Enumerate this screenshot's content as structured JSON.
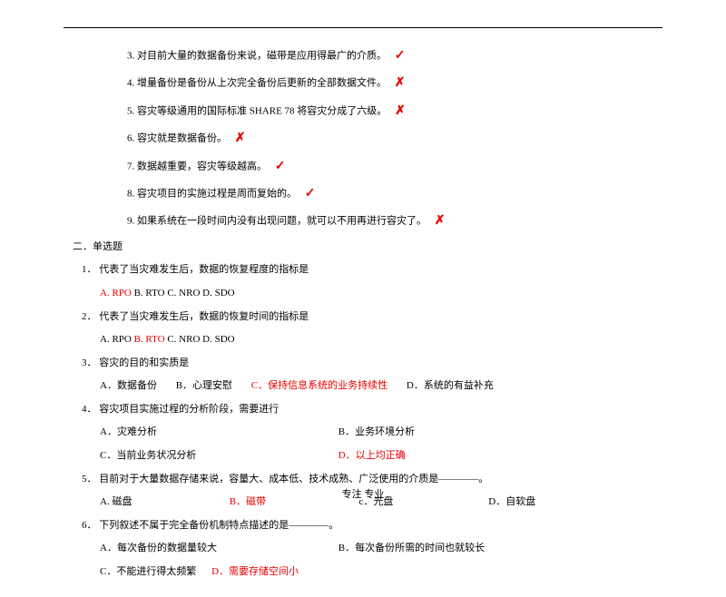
{
  "tf": {
    "items": [
      {
        "num": "3.",
        "text": "对目前大量的数据备份来说，磁带是应用得最广的介质。",
        "mark": "check"
      },
      {
        "num": "4.",
        "text": "增量备份是备份从上次完全备份后更新的全部数据文件。",
        "mark": "cross"
      },
      {
        "num": "5.",
        "text": "容灾等级通用的国际标准 SHARE 78 将容灾分成了六级。",
        "mark": "cross"
      },
      {
        "num": "6.",
        "text": "容灾就是数据备份。",
        "mark": "cross"
      },
      {
        "num": "7.",
        "text": "数据越重要，容灾等级越高。",
        "mark": "check"
      },
      {
        "num": "8.",
        "text": "容灾项目的实施过程是周而复始的。",
        "mark": "check"
      },
      {
        "num": "9.",
        "text": "如果系统在一段时间内没有出现问题，就可以不用再进行容灾了。",
        "mark": "cross"
      }
    ]
  },
  "section2_heading": "二．单选题",
  "mc": {
    "q1": {
      "num": "1．",
      "text": "代表了当灾难发生后，数据的恢复程度的指标是",
      "A": "A. RPO",
      "B": "B. RTO",
      "C": "C. NRO",
      "D": "D. SDO",
      "answer": "A"
    },
    "q2": {
      "num": "2．",
      "text": "代表了当灾难发生后，数据的恢复时间的指标是",
      "A": "A. RPO",
      "B": "B. RTO",
      "C": "C. NRO",
      "D": "D. SDO",
      "answer": "B"
    },
    "q3": {
      "num": "3．",
      "text": "容灾的目的和实质是",
      "A": "A．数据备份",
      "B": "B．心理安慰",
      "C": "C．保持信息系统的业务持续性",
      "D": "D．系统的有益补充",
      "answer": "C"
    },
    "q4": {
      "num": "4．",
      "text": "容灾项目实施过程的分析阶段，需要进行",
      "A": "A．灾难分析",
      "B": "B．业务环境分析",
      "C": "C．当前业务状况分析",
      "D": "D．以上均正确",
      "answer": "D"
    },
    "q5": {
      "num": "5．",
      "text": "目前对于大量数据存储来说，容量大、成本低、技术成熟、广泛使用的介质是――――。",
      "A": "A. 磁盘",
      "B": "B．磁带",
      "c": "c．光盘",
      "D": "D．自软盘",
      "answer": "B"
    },
    "q6": {
      "num": "6．",
      "text": "下列叙述不属于完全备份机制特点描述的是――――。",
      "A": "A．每次备份的数据量较大",
      "B": "B．每次备份所需的时间也就较长",
      "C": "C．不能进行得太频繁",
      "D": "D．需要存储空间小",
      "answer": "D"
    }
  },
  "footer": "专注 专业"
}
